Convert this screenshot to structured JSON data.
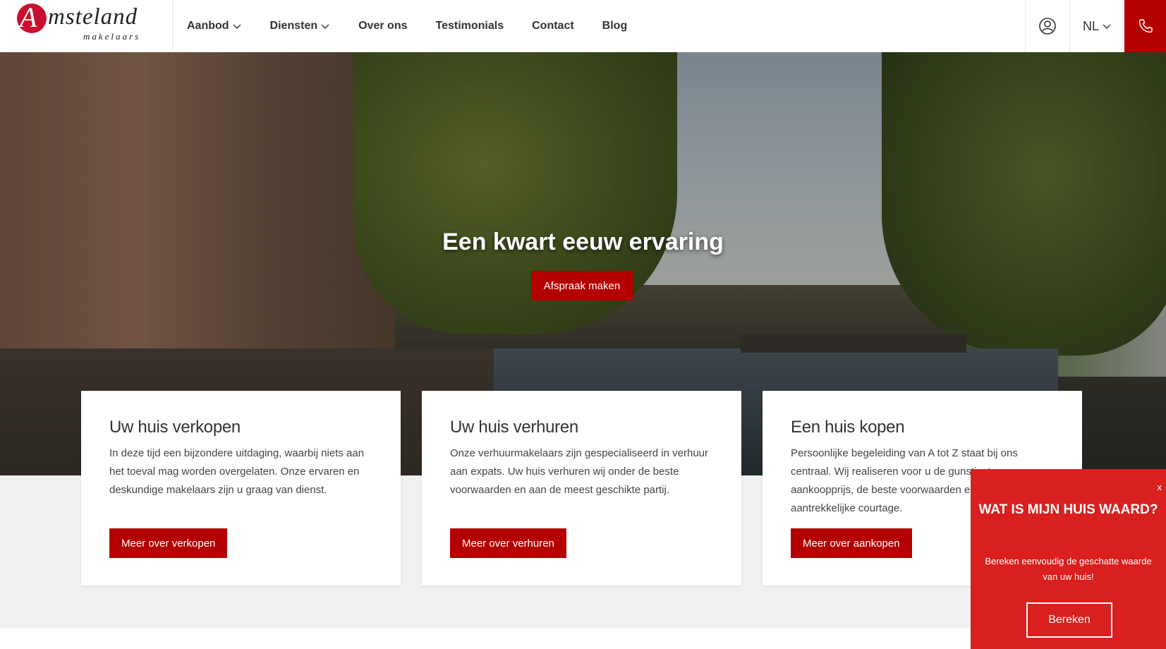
{
  "header": {
    "logo_initial": "A",
    "logo_word": "msteland",
    "logo_sub": "makelaars",
    "nav": [
      {
        "label": "Aanbod",
        "has_dropdown": true
      },
      {
        "label": "Diensten",
        "has_dropdown": true
      },
      {
        "label": "Over ons",
        "has_dropdown": false
      },
      {
        "label": "Testimonials",
        "has_dropdown": false
      },
      {
        "label": "Contact",
        "has_dropdown": false
      },
      {
        "label": "Blog",
        "has_dropdown": false
      }
    ],
    "language": "NL",
    "icons": {
      "account": "user-circle-icon",
      "phone": "phone-icon"
    }
  },
  "hero": {
    "title": "Een kwart eeuw ervaring",
    "cta": "Afspraak maken"
  },
  "cards": [
    {
      "title": "Uw huis verkopen",
      "text": "In deze tijd een bijzondere uitdaging, waarbij niets aan het toeval mag worden overgelaten. Onze ervaren en deskundige makelaars zijn u graag van dienst.",
      "button": "Meer over verkopen"
    },
    {
      "title": "Uw huis verhuren",
      "text": "Onze verhuurmakelaars zijn gespecialiseerd in verhuur aan expats. Uw huis verhuren wij onder de beste voorwaarden en aan de meest geschikte partij.",
      "button": "Meer over verhuren"
    },
    {
      "title": "Een huis kopen",
      "text": "Persoonlijke begeleiding van A tot Z staat bij ons centraal. Wij realiseren voor u de gunstigste aankoopprijs, de beste voorwaarden en een aantrekkelijke courtage.",
      "button": "Meer over aankopen"
    }
  ],
  "popup": {
    "close": "x",
    "title": "WAT IS MIJN HUIS WAARD?",
    "text": "Bereken eenvoudig de geschatte waarde van uw huis!",
    "button": "Bereken"
  },
  "colors": {
    "brand_red": "#b40000",
    "popup_red": "#d9201e",
    "band_grey": "#f0f0f0"
  }
}
